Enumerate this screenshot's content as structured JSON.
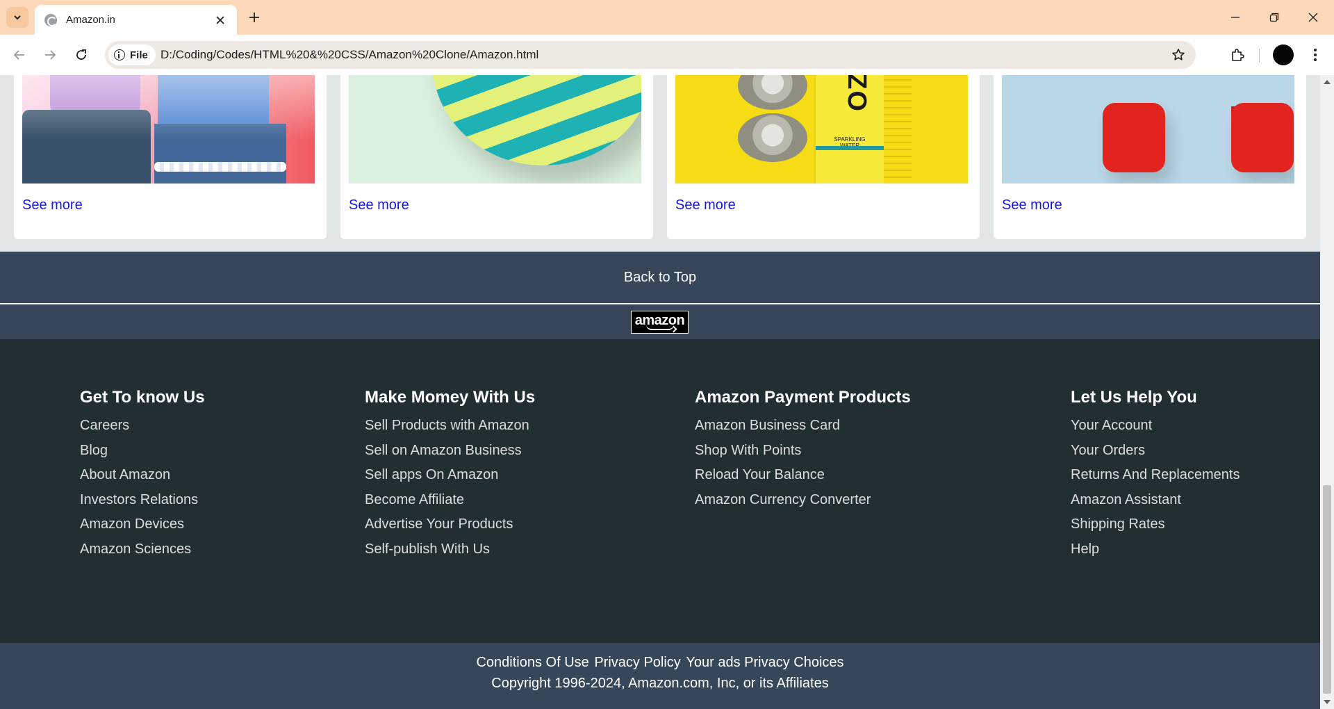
{
  "browser": {
    "tab_title": "Amazon.in",
    "file_chip": "File",
    "url": "D:/Coding/Codes/HTML%20&%20CSS/Amazon%20Clone/Amazon.html"
  },
  "cards": [
    {
      "see_more": "See more",
      "image": "fashion"
    },
    {
      "see_more": "See more",
      "image": "ball"
    },
    {
      "see_more": "See more",
      "image": "cans"
    },
    {
      "see_more": "See more",
      "image": "dumbbells"
    }
  ],
  "cans_bottle": {
    "brand": "ZO",
    "label": "SPARKLING WATER"
  },
  "back_to_top": "Back to Top",
  "logo": {
    "word": "amazon"
  },
  "footer_columns": [
    {
      "heading": "Get To know Us",
      "links": [
        "Careers",
        "Blog",
        "About Amazon",
        "Investors Relations",
        "Amazon Devices",
        "Amazon Sciences"
      ]
    },
    {
      "heading": "Make Momey With Us",
      "links": [
        "Sell Products with Amazon",
        "Sell on Amazon Business",
        "Sell apps On Amazon",
        "Become Affiliate",
        "Advertise Your Products",
        "Self-publish With Us"
      ]
    },
    {
      "heading": "Amazon Payment Products",
      "links": [
        "Amazon Business Card",
        "Shop With Points",
        "Reload Your Balance",
        "Amazon Currency Converter"
      ]
    },
    {
      "heading": "Let Us Help You",
      "links": [
        "Your Account",
        "Your Orders",
        "Returns And Replacements",
        "Amazon Assistant",
        "Shipping Rates",
        "Help"
      ]
    }
  ],
  "bottom": {
    "policy_links": [
      "Conditions Of Use",
      "Privacy Policy",
      "Your ads Privacy Choices"
    ],
    "copyright": "Copyright 1996-2024, Amazon.com, Inc, or its Affiliates"
  },
  "colors": {
    "tabbar": "#fdd9b9",
    "footer_light": "#37475a",
    "footer_dark": "#222f32",
    "link_blue": "#1414f0"
  }
}
